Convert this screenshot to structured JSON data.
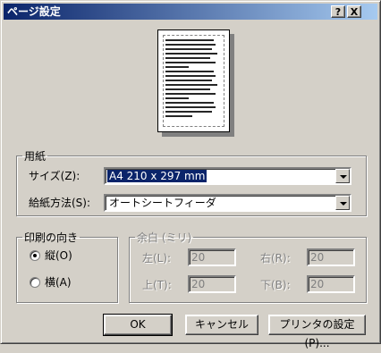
{
  "window": {
    "title": "ページ設定",
    "help_btn": "?",
    "close_btn": "X"
  },
  "paper": {
    "group_label": "用紙",
    "size_label": "サイズ(Z):",
    "size_value": "A4 210 x 297 mm",
    "source_label": "給紙方法(S):",
    "source_value": "オートシートフィーダ"
  },
  "orientation": {
    "group_label": "印刷の向き",
    "portrait_label": "縦(O)",
    "landscape_label": "横(A)",
    "selected": "portrait"
  },
  "margins": {
    "group_label": "余白 (ミリ)",
    "left_label": "左(L):",
    "left_value": "20",
    "right_label": "右(R):",
    "right_value": "20",
    "top_label": "上(T):",
    "top_value": "20",
    "bottom_label": "下(B):",
    "bottom_value": "20"
  },
  "buttons": {
    "ok": "OK",
    "cancel": "キャンセル",
    "printer": "プリンタの設定(P)..."
  },
  "colors": {
    "titlebar_start": "#0a246a",
    "titlebar_end": "#a6caf0",
    "selection": "#0a246a",
    "face": "#d4d0c8"
  }
}
